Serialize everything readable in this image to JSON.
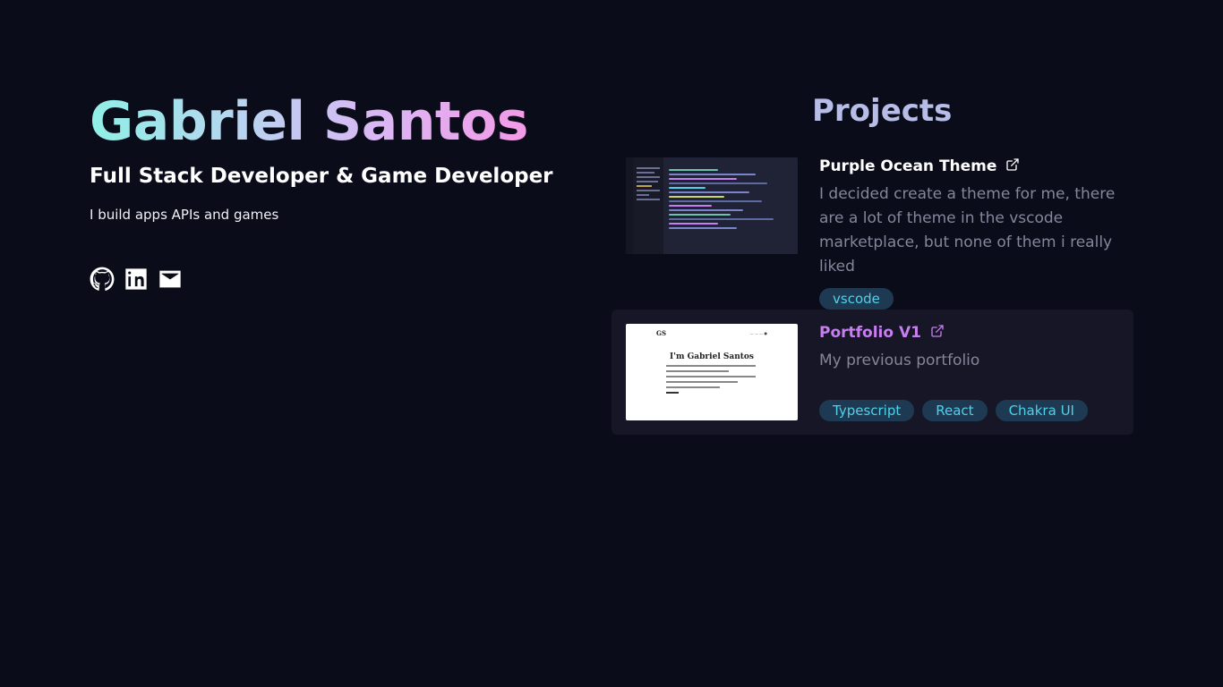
{
  "hero": {
    "name": "Gabriel Santos",
    "role": "Full Stack Developer & Game Developer",
    "tagline": "I build apps APIs and games",
    "socials": [
      {
        "icon": "github-icon",
        "label": "GitHub"
      },
      {
        "icon": "linkedin-icon",
        "label": "LinkedIn"
      },
      {
        "icon": "mail-icon",
        "label": "Email"
      }
    ]
  },
  "projects": {
    "title": "Projects",
    "items": [
      {
        "title": "Purple Ocean Theme",
        "description": "I decided create a theme for me, there are a lot of theme in the vscode marketplace, but none of them i really liked",
        "tags": [
          "vscode"
        ],
        "icon": "external-link-icon"
      },
      {
        "title": "Portfolio V1",
        "description": "My previous portfolio",
        "tags": [
          "Typescript",
          "React",
          "Chakra UI"
        ],
        "icon": "external-link-icon",
        "thumbnail": {
          "logo": "GS",
          "heading": "I'm Gabriel Santos"
        }
      }
    ]
  },
  "colors": {
    "background": "#0a0c1a",
    "card": "#161627",
    "tag_bg": "#1e3a52",
    "tag_text": "#4fd1ea",
    "accent_purple": "#c77ef0",
    "projects_title": "#b8bde8"
  }
}
